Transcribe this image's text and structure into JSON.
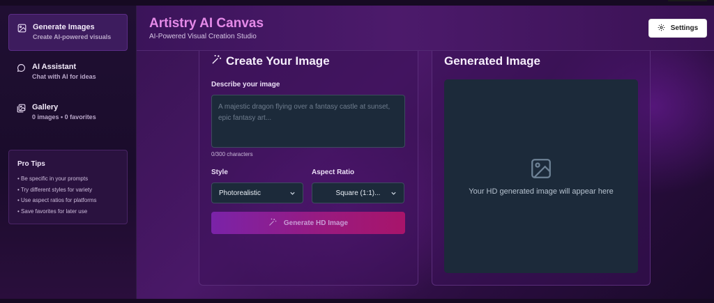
{
  "sidebar": {
    "items": [
      {
        "title": "Generate Images",
        "subtitle": "Create AI-powered visuals",
        "icon": "image-icon",
        "active": true
      },
      {
        "title": "AI Assistant",
        "subtitle": "Chat with AI for ideas",
        "icon": "chat-icon",
        "active": false
      },
      {
        "title": "Gallery",
        "subtitle": "0 images • 0 favorites",
        "icon": "gallery-icon",
        "active": false
      }
    ],
    "tips": {
      "title": "Pro Tips",
      "items": [
        "Be specific in your prompts",
        "Try different styles for variety",
        "Use aspect ratios for platforms",
        "Save favorites for later use"
      ]
    }
  },
  "header": {
    "title": "Artistry AI Canvas",
    "subtitle": "AI-Powered Visual Creation Studio",
    "settings_label": "Settings"
  },
  "create": {
    "title": "Create Your Image",
    "prompt_label": "Describe your image",
    "prompt_placeholder": "A majestic dragon flying over a fantasy castle at sunset, epic fantasy art...",
    "char_count": "0/300 characters",
    "style_label": "Style",
    "style_value": "Photorealistic",
    "ratio_label": "Aspect Ratio",
    "ratio_value": "Square (1:1)...",
    "generate_label": "Generate HD Image"
  },
  "result": {
    "title": "Generated Image",
    "placeholder_text": "Your HD generated image will appear here"
  },
  "colors": {
    "accent_title": "#e58ae8",
    "generate_gradient_start": "#7a23a8",
    "generate_gradient_end": "#a8146a",
    "field_background": "#1c2a3a"
  }
}
